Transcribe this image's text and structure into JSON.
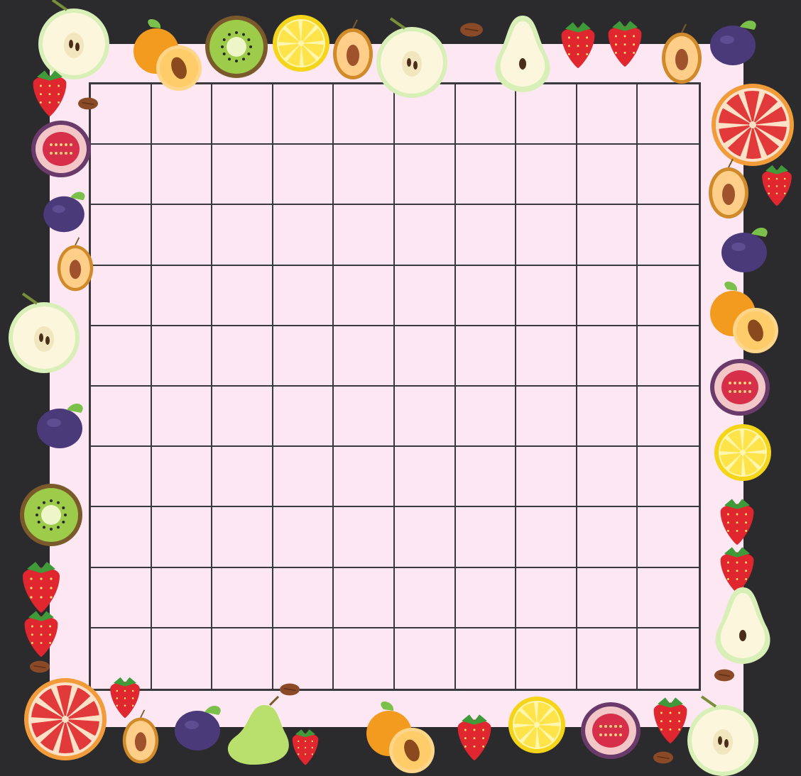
{
  "board": {
    "rows": 10,
    "cols": 10,
    "colors": {
      "background": "#2b2b2d",
      "paper": "#fde7f2",
      "grid_line": "#3a3a3c"
    }
  },
  "border_decorations": [
    "apple-half-icon",
    "apricot-icon",
    "kiwi-half-icon",
    "lemon-slice-icon",
    "plum-half-icon",
    "apple-half-icon",
    "almond-icon",
    "pear-half-icon",
    "strawberry-icon",
    "strawberry-icon",
    "plum-half-icon",
    "plum-icon",
    "strawberry-icon",
    "almond-icon",
    "fig-half-icon",
    "plum-icon",
    "plum-half-icon",
    "apple-half-icon",
    "plum-icon",
    "kiwi-half-icon",
    "strawberry-icon",
    "strawberry-icon",
    "almond-icon",
    "grapefruit-slice-icon",
    "strawberry-icon",
    "plum-half-icon",
    "plum-icon",
    "apricot-icon",
    "fig-half-icon",
    "lemon-slice-icon",
    "strawberry-icon",
    "strawberry-icon",
    "pear-half-icon",
    "almond-icon",
    "grapefruit-slice-icon",
    "strawberry-icon",
    "plum-half-icon",
    "plum-icon",
    "almond-icon",
    "pear-icon",
    "strawberry-icon",
    "apricot-icon",
    "strawberry-icon",
    "lemon-slice-icon",
    "fig-half-icon",
    "strawberry-icon",
    "almond-icon",
    "apple-half-icon"
  ]
}
